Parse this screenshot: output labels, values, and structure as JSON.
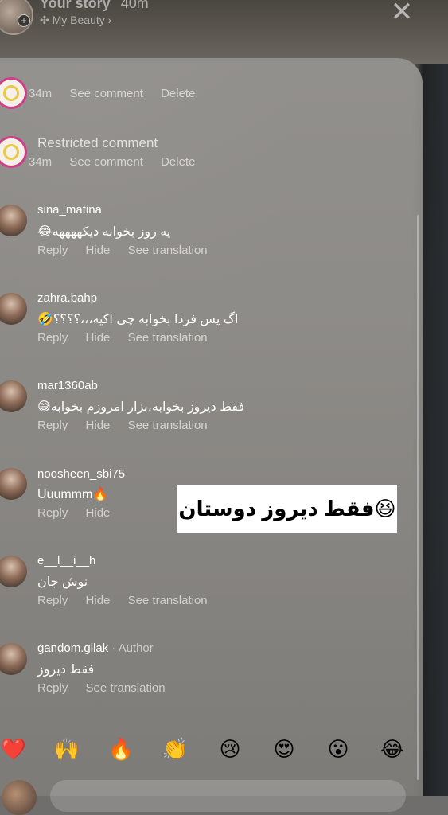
{
  "story": {
    "title": "Your story",
    "time": "40m",
    "subtitle": "✣ My Beauty ›"
  },
  "icons": {
    "close": "close-icon",
    "plus": "plus-icon"
  },
  "comments": [
    {
      "type": "own",
      "time": "34m",
      "actions": [
        "See comment",
        "Delete"
      ]
    },
    {
      "type": "restricted",
      "label": "Restricted comment",
      "time": "34m",
      "actions": [
        "See comment",
        "Delete"
      ]
    },
    {
      "type": "user",
      "username": "sina_matina",
      "text": "😂یه روز بخوابه دیکههههه",
      "actions": [
        "Reply",
        "Hide",
        "See translation"
      ]
    },
    {
      "type": "user",
      "username": "zahra.bahp",
      "text": "🤣اگ پس فردا بخوابه چی اکیه،،،؟؟؟؟",
      "actions": [
        "Reply",
        "Hide",
        "See translation"
      ]
    },
    {
      "type": "user",
      "username": "mar1360ab",
      "text": "😅فقط دیروز بخوابه،بزار امروزم بخوابه",
      "actions": [
        "Reply",
        "Hide",
        "See translation"
      ]
    },
    {
      "type": "user",
      "username": "noosheen_sbi75",
      "text": "Uuummm🔥",
      "actions": [
        "Reply",
        "Hide"
      ]
    },
    {
      "type": "user",
      "username": "e__l__i__h",
      "text": "نوش جان",
      "actions": [
        "Reply",
        "Hide",
        "See translation"
      ]
    },
    {
      "type": "author",
      "username": "gandom.gilak",
      "author_label": "· Author",
      "text": "فقط دیروز",
      "actions": [
        "Reply",
        "See translation"
      ]
    }
  ],
  "sticker": {
    "text": "فقط دیروز دوستان😆"
  },
  "reactions": [
    "❤️",
    "🙌",
    "🔥",
    "👏",
    "😢",
    "😍",
    "😮",
    "😂"
  ],
  "colors": {
    "accent_ring": "#cf3f86",
    "sheet": "#96948f"
  }
}
